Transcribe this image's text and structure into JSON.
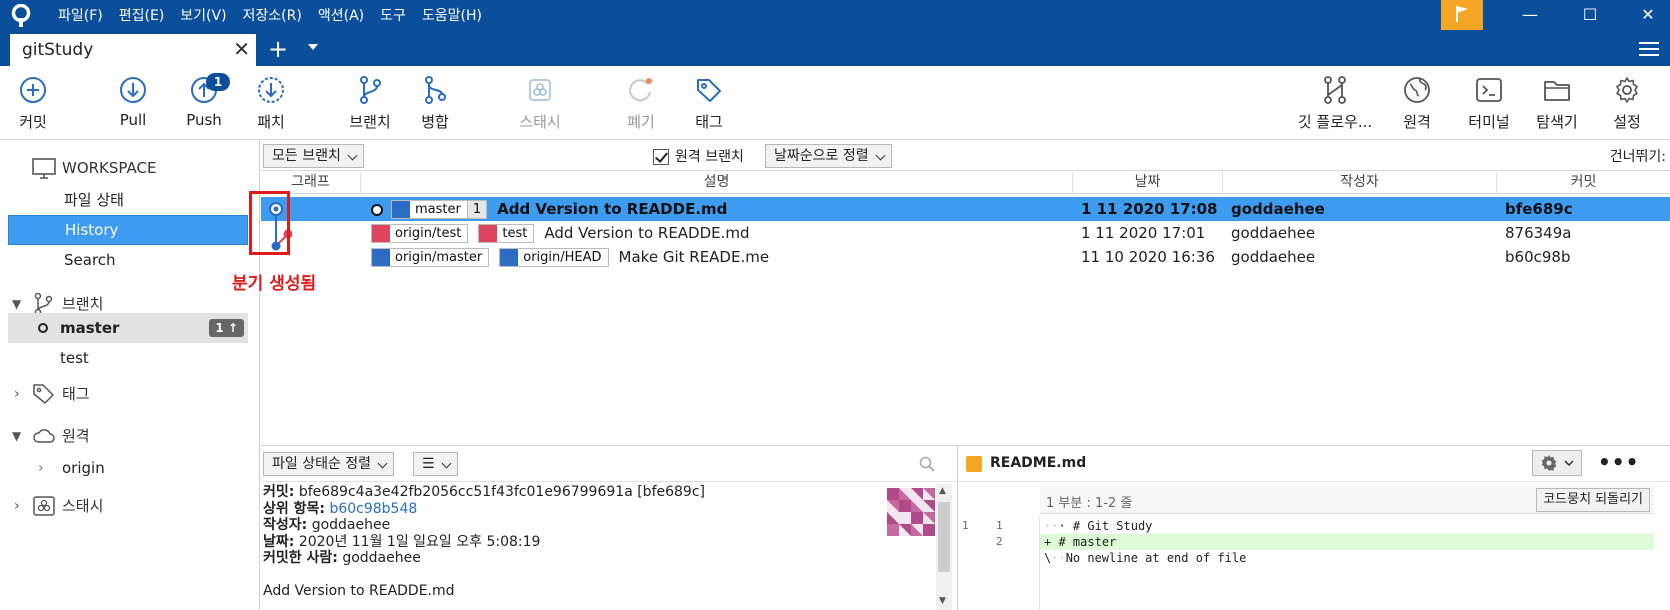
{
  "menu": [
    "파일(F)",
    "편집(E)",
    "보기(V)",
    "저장소(R)",
    "액션(A)",
    "도구",
    "도움말(H)"
  ],
  "window": {
    "minimize": "—",
    "maximize": "☐",
    "close": "✕"
  },
  "tab": {
    "title": "gitStudy",
    "close": "✕",
    "add": "+"
  },
  "toolbar": {
    "commit": "커밋",
    "pull": "Pull",
    "push": "Push",
    "push_badge": "1",
    "patch": "패치",
    "branch": "브랜치",
    "merge": "병합",
    "stash": "스태시",
    "discard": "폐기",
    "tag": "태그",
    "gitflow": "깃 플로우...",
    "remote": "원격",
    "terminal": "터미널",
    "explorer": "탐색기",
    "settings": "설정"
  },
  "sidebar": {
    "workspace": "WORKSPACE",
    "file_status": "파일 상태",
    "history": "History",
    "search": "Search",
    "branches_header": "브랜치",
    "branches": [
      {
        "name": "master",
        "ahead": "1 ↑"
      },
      {
        "name": "test"
      }
    ],
    "tags_header": "태그",
    "remotes_header": "원격",
    "remotes": [
      "origin"
    ],
    "stash_header": "스태시"
  },
  "filter": {
    "branches": "모든 브랜치",
    "remote_branches": "원격 브랜치",
    "sort": "날짜순으로 정렬",
    "skip": "건너뛰기:"
  },
  "table": {
    "headers": {
      "graph": "그래프",
      "desc": "설명",
      "date": "날짜",
      "author": "작성자",
      "commit": "커밋"
    },
    "rows": [
      {
        "refs": [
          {
            "name": "master",
            "count": "1",
            "color": "blue"
          }
        ],
        "desc": "Add Version to READDE.md",
        "date": "1 11 2020 17:08",
        "author": "goddaehee",
        "hash": "bfe689c"
      },
      {
        "refs": [
          {
            "name": "origin/test",
            "color": "pink"
          },
          {
            "name": "test",
            "color": "pink"
          }
        ],
        "desc": "Add Version to READDE.md",
        "date": "1 11 2020 17:01",
        "author": "goddaehee",
        "hash": "876349a"
      },
      {
        "refs": [
          {
            "name": "origin/master",
            "color": "blue"
          },
          {
            "name": "origin/HEAD",
            "color": "blue"
          }
        ],
        "desc": "Make Git READE.me",
        "date": "11 10 2020 16:36",
        "author": "goddaehee",
        "hash": "b60c98b"
      }
    ]
  },
  "annotation": "분기 생성됨",
  "lower_left": {
    "sort": "파일 상태순 정렬",
    "view": "☰"
  },
  "details": {
    "commit_label": "커밋:",
    "commit_value": "bfe689c4a3e42fb2056cc51f43fc01e96799691a [bfe689c]",
    "parent_label": "상위 항목:",
    "parent_value": "b60c98b548",
    "author_label": "작성자:",
    "author_value": "goddaehee",
    "date_label": "날짜:",
    "date_value": "2020년 11월 1일 일요일 오후 5:08:19",
    "committer_label": "커밋한 사람:",
    "committer_value": "goddaehee",
    "message": "Add Version to READDE.md"
  },
  "diff": {
    "file": "README.md",
    "hunk": "1 부분 : 1-2 줄",
    "revert": "코드뭉치 되돌리기",
    "lines": [
      {
        "old": "1",
        "new": "1",
        "prefix": "·",
        "text": "# Git Study",
        "type": "ctx"
      },
      {
        "old": "",
        "new": "2",
        "prefix": "+",
        "text": "# master",
        "type": "add"
      },
      {
        "old": "",
        "new": "",
        "prefix": "\\",
        "text": "No newline at end of file",
        "type": "meta"
      }
    ]
  }
}
